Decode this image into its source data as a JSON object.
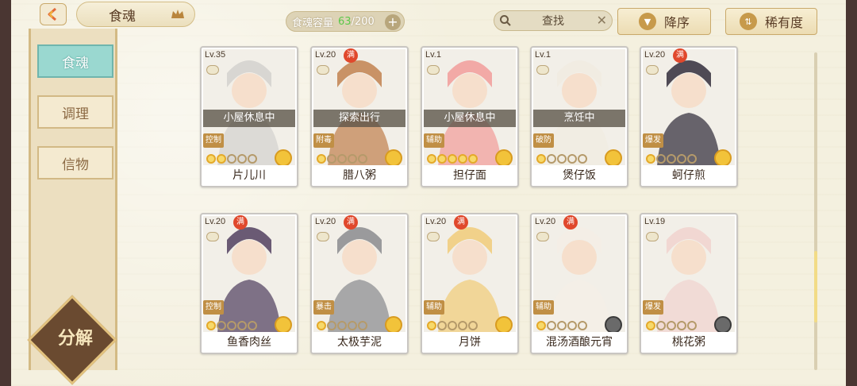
{
  "header": {
    "title": "食魂",
    "capacity_label": "食魂容量",
    "capacity_current": "63",
    "capacity_total": "/200",
    "search_label": "查找",
    "sort_order_label": "降序",
    "sort_key_label": "稀有度"
  },
  "sidebar": {
    "items": [
      {
        "label": "食魂"
      },
      {
        "label": "调理"
      },
      {
        "label": "信物"
      }
    ],
    "decompose_label": "分解"
  },
  "cards": [
    {
      "level": "Lv.35",
      "maxed": false,
      "status": "小屋休息中",
      "role": "控制",
      "stars": 2,
      "name": "片儿川",
      "art_color": "#d8d6d2"
    },
    {
      "level": "Lv.20",
      "maxed": true,
      "status": "探索出行",
      "role": "附毒",
      "stars": 1,
      "name": "腊八粥",
      "art_color": "#c99266"
    },
    {
      "level": "Lv.1",
      "maxed": false,
      "status": "小屋休息中",
      "role": "辅助",
      "stars": 5,
      "name": "担仔面",
      "art_color": "#f2a9a6"
    },
    {
      "level": "Lv.1",
      "maxed": false,
      "status": "烹饪中",
      "role": "破防",
      "stars": 1,
      "name": "煲仔饭",
      "art_color": "#f1ece2"
    },
    {
      "level": "Lv.20",
      "maxed": true,
      "status": "",
      "role": "爆发",
      "stars": 1,
      "name": "蚵仔煎",
      "art_color": "#4f4a55"
    },
    {
      "level": "Lv.20",
      "maxed": true,
      "status": "",
      "role": "控制",
      "stars": 1,
      "name": "鱼香肉丝",
      "art_color": "#6a5a74"
    },
    {
      "level": "Lv.20",
      "maxed": true,
      "status": "",
      "role": "暴击",
      "stars": 1,
      "name": "太极芋泥",
      "art_color": "#9a9a9c"
    },
    {
      "level": "Lv.20",
      "maxed": true,
      "status": "",
      "role": "辅助",
      "stars": 1,
      "name": "月饼",
      "art_color": "#f1d18a"
    },
    {
      "level": "Lv.20",
      "maxed": true,
      "status": "",
      "role": "辅助",
      "stars": 1,
      "name": "混汤酒酿元宵",
      "art_color": "#f4eee6"
    },
    {
      "level": "Lv.19",
      "maxed": false,
      "status": "",
      "role": "爆发",
      "stars": 1,
      "name": "桃花粥",
      "art_color": "#f1d7d2"
    }
  ],
  "full_badge": "满"
}
